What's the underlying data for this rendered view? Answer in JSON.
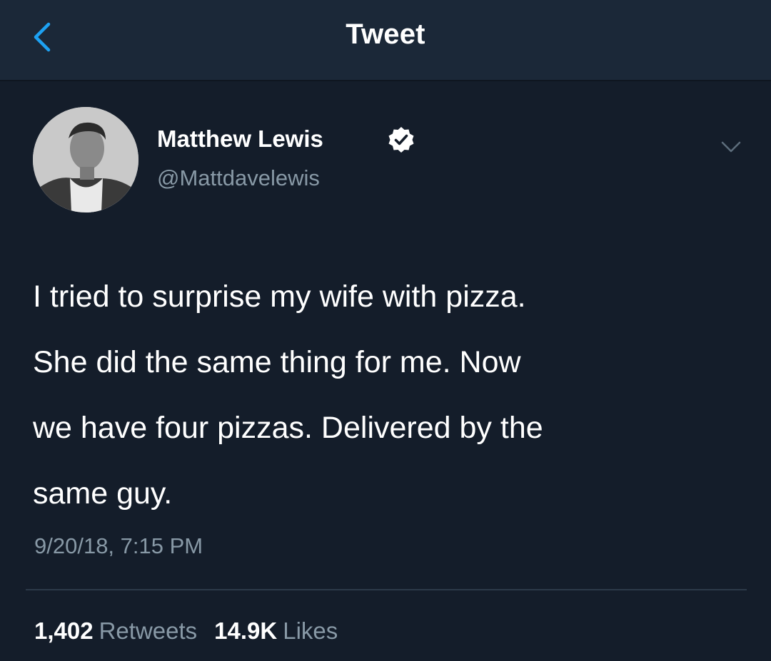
{
  "nav": {
    "title": "Tweet",
    "back_icon": "chevron-left-icon"
  },
  "colors": {
    "background": "#141d2a",
    "nav_background": "#1b2838",
    "accent": "#1da1f2",
    "secondary_text": "#8899a6"
  },
  "author": {
    "name": "Matthew Lewis",
    "handle": "@Mattdavelewis",
    "verified_icon": "verified-badge-icon",
    "options_icon": "chevron-down-icon"
  },
  "tweet": {
    "lines": [
      "I tried to surprise my wife with pizza.",
      "She did the same thing for me. Now",
      "we have four pizzas. Delivered by the",
      "same guy."
    ],
    "timestamp": "9/20/18, 7:15 PM"
  },
  "stats": {
    "retweets_count": "1,402",
    "retweets_label": "Retweets",
    "likes_count": "14.9K",
    "likes_label": "Likes"
  }
}
